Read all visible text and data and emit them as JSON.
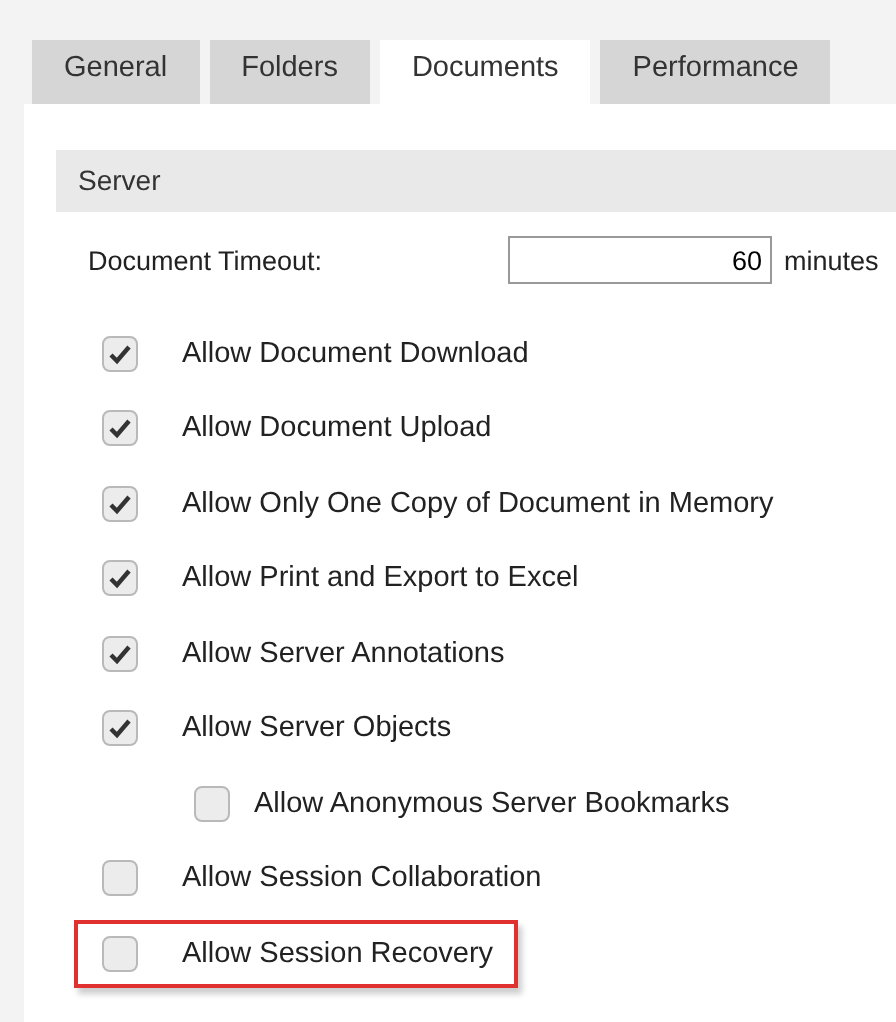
{
  "tabs": [
    {
      "label": "General",
      "selected": false
    },
    {
      "label": "Folders",
      "selected": false
    },
    {
      "label": "Documents",
      "selected": true
    },
    {
      "label": "Performance",
      "selected": false
    }
  ],
  "section": {
    "title": "Server"
  },
  "timeout": {
    "label": "Document Timeout:",
    "value": "60",
    "unit": "minutes"
  },
  "options": [
    {
      "label": "Allow Document Download",
      "checked": true,
      "highlighted": false
    },
    {
      "label": "Allow Document Upload",
      "checked": true,
      "highlighted": false
    },
    {
      "label": "Allow Only One Copy of Document in Memory",
      "checked": true,
      "highlighted": false
    },
    {
      "label": "Allow Print and Export to Excel",
      "checked": true,
      "highlighted": false
    },
    {
      "label": "Allow Server Annotations",
      "checked": true,
      "highlighted": false
    },
    {
      "label": "Allow Server Objects",
      "checked": true,
      "highlighted": false,
      "children": [
        {
          "label": "Allow Anonymous Server Bookmarks",
          "checked": false,
          "highlighted": false
        }
      ]
    },
    {
      "label": "Allow Session Collaboration",
      "checked": false,
      "highlighted": false
    },
    {
      "label": "Allow Session Recovery",
      "checked": false,
      "highlighted": true
    }
  ]
}
